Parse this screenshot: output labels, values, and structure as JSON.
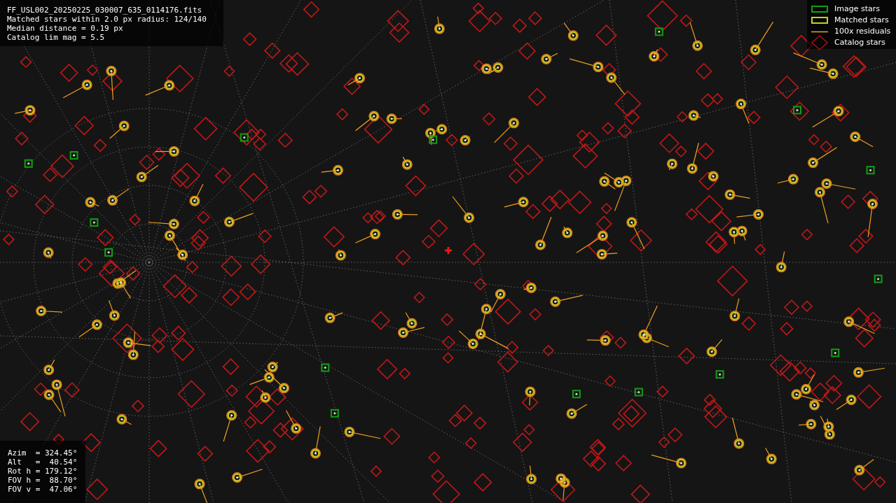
{
  "file_info": [
    "FF_USL002_20250225_030007_635_0114176.fits",
    "Matched stars within 2.0 px radius: 124/140",
    "Median distance = 0.19 px",
    "Catalog lim mag = 5.5"
  ],
  "legend": [
    {
      "kind": "image",
      "label": "Image stars"
    },
    {
      "kind": "matched",
      "label": "Matched stars"
    },
    {
      "kind": "residual",
      "label": "100x residuals"
    },
    {
      "kind": "catalog",
      "label": "Catalog stars"
    }
  ],
  "pointing": [
    "Azim  = 324.45°",
    "Alt   =  40.54°",
    "Rot h = 179.12°",
    "FOV h =  88.70°",
    "FOV v =  47.06°"
  ]
}
